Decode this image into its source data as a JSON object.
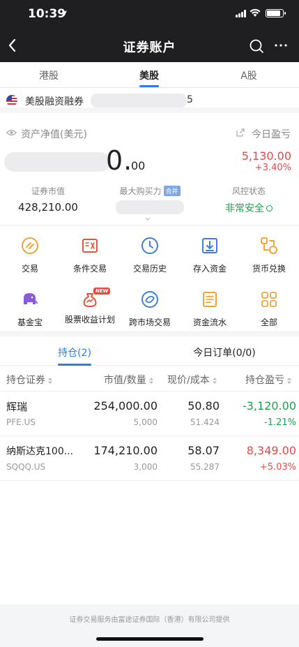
{
  "status": {
    "time": "10:39"
  },
  "nav": {
    "title": "证券账户"
  },
  "market_tabs": [
    {
      "label": "港股"
    },
    {
      "label": "美股",
      "active": true
    },
    {
      "label": "A股"
    }
  ],
  "account": {
    "name": "美股融资融券",
    "suffix": "5"
  },
  "asset": {
    "net_label": "资产净值(美元)",
    "net_value_visible": "0.",
    "net_decimal": "00",
    "today_pl_label": "今日盈亏",
    "today_pl": "5,130.00",
    "today_pl_pct": "+3.40%",
    "metrics": {
      "market_value_label": "证券市值",
      "market_value": "428,210.00",
      "buying_power_label": "最大购买力",
      "merge_badge": "合并",
      "risk_label": "风控状态",
      "risk_value": "非常安全"
    }
  },
  "functions": [
    {
      "label": "交易",
      "icon": "trade-icon"
    },
    {
      "label": "条件交易",
      "icon": "conditional-trade-icon"
    },
    {
      "label": "交易历史",
      "icon": "history-clock-icon"
    },
    {
      "label": "存入资金",
      "icon": "deposit-icon"
    },
    {
      "label": "货币兑换",
      "icon": "currency-exchange-icon"
    },
    {
      "label": "基金宝",
      "icon": "elephant-fund-icon"
    },
    {
      "label": "股票收益计划",
      "icon": "money-bag-icon",
      "badge": "NEW"
    },
    {
      "label": "跨市场交易",
      "icon": "cross-market-icon"
    },
    {
      "label": "资金流水",
      "icon": "cash-flow-icon"
    },
    {
      "label": "全部",
      "icon": "grid-all-icon"
    }
  ],
  "hold_tabs": [
    {
      "label": "持仓(2)",
      "active": true
    },
    {
      "label": "今日订单(0/0)"
    }
  ],
  "table": {
    "headers": [
      "持仓证券",
      "市值/数量",
      "现价/成本",
      "持仓盈亏"
    ],
    "rows": [
      {
        "name": "辉瑞",
        "code": "PFE.US",
        "market_value": "254,000.00",
        "quantity": "5,000",
        "price": "50.80",
        "cost": "51.424",
        "pl": "-3,120.00",
        "pl_pct": "-1.21%",
        "direction": "down"
      },
      {
        "name": "纳斯达克100...",
        "code": "SQQQ.US",
        "market_value": "174,210.00",
        "quantity": "3,000",
        "price": "58.07",
        "cost": "55.287",
        "pl": "8,349.00",
        "pl_pct": "+5.03%",
        "direction": "up"
      }
    ]
  },
  "footer": {
    "text": "证券交易服务由富途证券国际（香港）有限公司提供"
  },
  "colors": {
    "accent": "#2b7de9",
    "up": "#e34a4a",
    "down": "#1aa34a",
    "header_bg": "#1f1f21"
  }
}
